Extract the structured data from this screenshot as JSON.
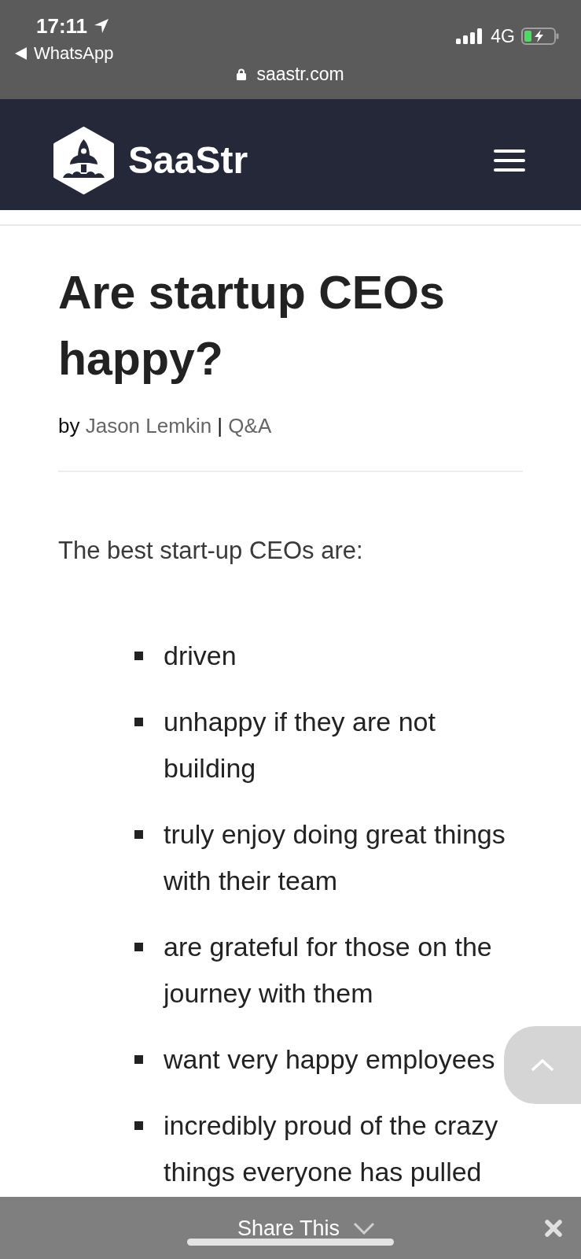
{
  "status_bar": {
    "time": "17:11",
    "back_label": "WhatsApp",
    "network": "4G"
  },
  "address_bar": {
    "url": "saastr.com"
  },
  "site_header": {
    "logo_text": "SaaStr"
  },
  "article": {
    "title": "Are startup CEOs happy?",
    "byline": {
      "prefix": "by",
      "author": "Jason Lemkin",
      "separator": "|",
      "category": "Q&A"
    },
    "intro": "The best start-up CEOs are:",
    "list": [
      "driven",
      "unhappy if they are not building",
      "truly enjoy doing great things with their team",
      "are grateful for those on the journey with them",
      "want very happy employees",
      "incredibly proud of the crazy things everyone has pulled"
    ]
  },
  "share_bar": {
    "label": "Share This"
  }
}
